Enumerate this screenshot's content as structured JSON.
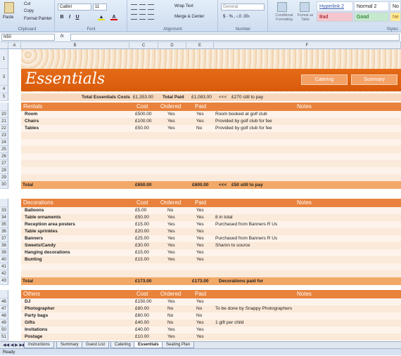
{
  "ribbon": {
    "clipboard": {
      "paste": "Paste",
      "cut": "Cut",
      "copy": "Copy",
      "format_painter": "Format Painter",
      "label": "Clipboard"
    },
    "font": {
      "name": "Calibri",
      "size": "11",
      "label": "Font"
    },
    "alignment": {
      "wrap": "Wrap Text",
      "merge": "Merge & Center",
      "label": "Alignment"
    },
    "number": {
      "format": "General",
      "label": "Number"
    },
    "styles": {
      "conditional": "Conditional Formatting",
      "format_table": "Format as Table",
      "hyperlink": "Hyperlink 2",
      "normal2": "Normal 2",
      "no": "No",
      "bad": "Bad",
      "good": "Good",
      "ne": "Ne",
      "label": "Styles"
    }
  },
  "formula_bar": {
    "name_box": "N50",
    "fx": "fx"
  },
  "columns": [
    "A",
    "B",
    "C",
    "D",
    "E",
    "F"
  ],
  "header": {
    "title": "Essentials",
    "catering_btn": "Catering",
    "summary_btn": "Summary"
  },
  "summary": {
    "label": "Total Essentials Costs",
    "cost": "£1,353.00",
    "paid_label": "Total Paid",
    "paid": "£1,083.00",
    "arrows": "<<<",
    "note": "£270 still to pay"
  },
  "sections": [
    {
      "name": "Rentals",
      "cols": [
        "Cost",
        "Ordered",
        "Paid",
        "Notes"
      ],
      "rows": [
        {
          "r": "20",
          "item": "Room",
          "cost": "£500.00",
          "ordered": "Yes",
          "paid": "Yes",
          "notes": "Room booked at golf club"
        },
        {
          "r": "21",
          "item": "Chairs",
          "cost": "£100.00",
          "ordered": "Yes",
          "paid": "Yes",
          "notes": "Provided by golf club for fee"
        },
        {
          "r": "22",
          "item": "Tables",
          "cost": "£50.00",
          "ordered": "Yes",
          "paid": "No",
          "notes": "Provided by golf club for fee"
        },
        {
          "r": "23"
        },
        {
          "r": "24"
        },
        {
          "r": "25"
        },
        {
          "r": "26"
        },
        {
          "r": "27"
        },
        {
          "r": "28"
        },
        {
          "r": "29"
        }
      ],
      "total": {
        "r": "30",
        "label": "Total",
        "cost": "£650.00",
        "paid": "£600.00",
        "arrows": "<<<",
        "note": "£50 still to pay"
      }
    },
    {
      "name": "Decorations",
      "cols": [
        "Cost",
        "Ordered",
        "Paid",
        "Notes"
      ],
      "rows": [
        {
          "r": "33",
          "item": "Balloons",
          "cost": "£5.00",
          "ordered": "No",
          "paid": "Yes",
          "notes": ""
        },
        {
          "r": "34",
          "item": "Table ornaments",
          "cost": "£50.00",
          "ordered": "Yes",
          "paid": "Yes",
          "notes": "8 in total"
        },
        {
          "r": "35",
          "item": "Reception area posters",
          "cost": "£15.00",
          "ordered": "Yes",
          "paid": "Yes",
          "notes": "Purchased from Banners R Us"
        },
        {
          "r": "36",
          "item": "Table sprinkles",
          "cost": "£20.00",
          "ordered": "Yes",
          "paid": "Yes",
          "notes": ""
        },
        {
          "r": "37",
          "item": "Banners",
          "cost": "£25.00",
          "ordered": "Yes",
          "paid": "Yes",
          "notes": "Purchased from Banners R Us"
        },
        {
          "r": "38",
          "item": "Sweets/Candy",
          "cost": "£30.00",
          "ordered": "Yes",
          "paid": "Yes",
          "notes": "Sharon to source"
        },
        {
          "r": "39",
          "item": "Hanging decorations",
          "cost": "£15.00",
          "ordered": "Yes",
          "paid": "Yes",
          "notes": ""
        },
        {
          "r": "40",
          "item": "Bunting",
          "cost": "£15.00",
          "ordered": "Yes",
          "paid": "Yes",
          "notes": ""
        },
        {
          "r": "41"
        },
        {
          "r": "42"
        }
      ],
      "total": {
        "r": "43",
        "label": "Total",
        "cost": "£173.00",
        "paid": "£173.00",
        "arrows": "",
        "note": "Decorations paid for"
      }
    },
    {
      "name": "Others",
      "cols": [
        "Cost",
        "Ordered",
        "Paid",
        "Notes"
      ],
      "rows": [
        {
          "r": "46",
          "item": "DJ",
          "cost": "£150.00",
          "ordered": "Yes",
          "paid": "Yes",
          "notes": ""
        },
        {
          "r": "47",
          "item": "Photographer",
          "cost": "£80.00",
          "ordered": "No",
          "paid": "No",
          "notes": "To be done by Snappy Photographers"
        },
        {
          "r": "48",
          "item": "Party bags",
          "cost": "£60.00",
          "ordered": "No",
          "paid": "No",
          "notes": ""
        },
        {
          "r": "49",
          "item": "Gifts",
          "cost": "£40.00",
          "ordered": "No",
          "paid": "Yes",
          "notes": "1 gift per child"
        },
        {
          "r": "50",
          "item": "Invitations",
          "cost": "£40.00",
          "ordered": "Yes",
          "paid": "Yes",
          "notes": ""
        },
        {
          "r": "51",
          "item": "Postage",
          "cost": "£10.00",
          "ordered": "Yes",
          "paid": "Yes",
          "notes": ""
        }
      ]
    }
  ],
  "row_headers_top": [
    "1",
    "2",
    "3",
    "4",
    "5"
  ],
  "tabs": [
    "Instructions",
    "Summary",
    "Guest List",
    "Catering",
    "Essentials",
    "Seating Plan"
  ],
  "active_tab": "Essentials",
  "status": "Ready"
}
